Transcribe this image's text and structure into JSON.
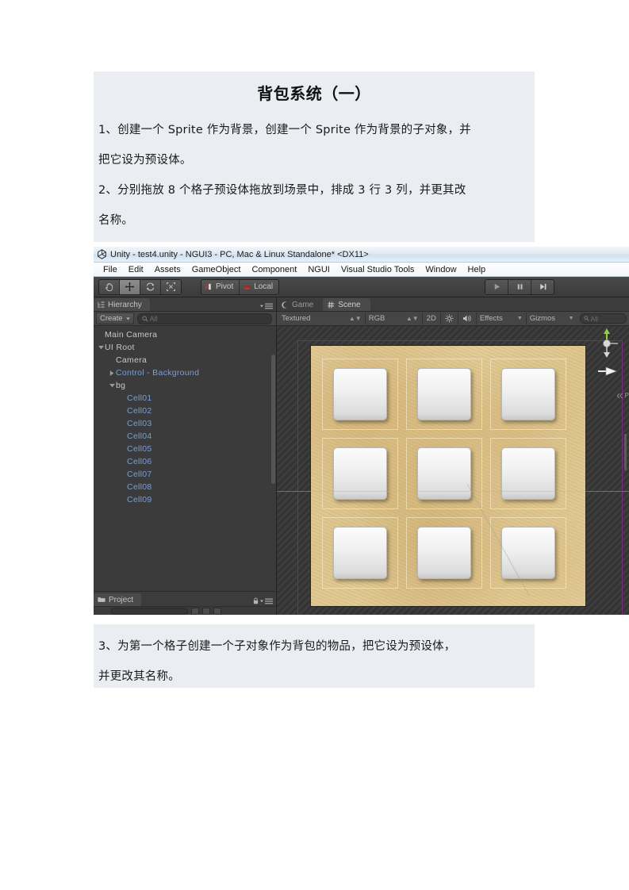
{
  "document": {
    "title": "背包系统（一）",
    "paragraphs_top": [
      "1、创建一个 Sprite 作为背景，创建一个 Sprite 作为背景的子对象，并",
      "把它设为预设体。",
      "2、分别拖放 8 个格子预设体拖放到场景中，排成 3 行 3 列，并更其改",
      "名称。"
    ],
    "paragraphs_bottom": [
      "3、为第一个格子创建一个子对象作为背包的物品，把它设为预设体，",
      "并更改其名称。"
    ],
    "background_color": "#eaeef2"
  },
  "unity": {
    "titlebar": {
      "text": "Unity - test4.unity - NGUI3 - PC, Mac & Linux Standalone* <DX11>",
      "icon": "unity-logo-icon"
    },
    "menubar": [
      "File",
      "Edit",
      "Assets",
      "GameObject",
      "Component",
      "NGUI",
      "Visual Studio Tools",
      "Window",
      "Help"
    ],
    "toolbar": {
      "transform_tools": [
        {
          "name": "hand-tool",
          "icon": "hand-icon",
          "active": false
        },
        {
          "name": "move-tool",
          "icon": "move-arrows-icon",
          "active": true
        },
        {
          "name": "rotate-tool",
          "icon": "rotate-icon",
          "active": false
        },
        {
          "name": "scale-tool",
          "icon": "scale-icon",
          "active": false
        }
      ],
      "pivot_label": "Pivot",
      "local_label": "Local",
      "play_buttons": [
        {
          "name": "play-button",
          "icon": "play-icon"
        },
        {
          "name": "pause-button",
          "icon": "pause-icon"
        },
        {
          "name": "step-button",
          "icon": "step-icon"
        }
      ]
    },
    "hierarchy": {
      "tab_label": "Hierarchy",
      "tab_icon": "hierarchy-icon",
      "create_label": "Create",
      "search_placeholder": "All",
      "tree": [
        {
          "label": "Main Camera",
          "indent": 0,
          "arrow": "none",
          "prefab": false
        },
        {
          "label": "UI Root",
          "indent": 0,
          "arrow": "down",
          "prefab": false
        },
        {
          "label": "Camera",
          "indent": 1,
          "arrow": "none",
          "prefab": false
        },
        {
          "label": "Control - Background",
          "indent": 1,
          "arrow": "right",
          "prefab": true
        },
        {
          "label": "bg",
          "indent": 1,
          "arrow": "down",
          "prefab": false
        },
        {
          "label": "Cell01",
          "indent": 2,
          "arrow": "none",
          "prefab": true
        },
        {
          "label": "Cell02",
          "indent": 2,
          "arrow": "none",
          "prefab": true
        },
        {
          "label": "Cell03",
          "indent": 2,
          "arrow": "none",
          "prefab": true
        },
        {
          "label": "Cell04",
          "indent": 2,
          "arrow": "none",
          "prefab": true
        },
        {
          "label": "Cell05",
          "indent": 2,
          "arrow": "none",
          "prefab": true
        },
        {
          "label": "Cell06",
          "indent": 2,
          "arrow": "none",
          "prefab": true
        },
        {
          "label": "Cell07",
          "indent": 2,
          "arrow": "none",
          "prefab": true
        },
        {
          "label": "Cell08",
          "indent": 2,
          "arrow": "none",
          "prefab": true
        },
        {
          "label": "Cell09",
          "indent": 2,
          "arrow": "none",
          "prefab": true
        }
      ],
      "prefab_text_color": "#7a9fd4"
    },
    "project": {
      "tab_label": "Project",
      "tab_icon": "folder-icon",
      "lock_icon": "lock-icon"
    },
    "scene_panel": {
      "tabs": [
        {
          "label": "Game",
          "icon": "game-icon",
          "active": false
        },
        {
          "label": "Scene",
          "icon": "scene-grid-icon",
          "active": true
        }
      ],
      "toolbar": {
        "draw_mode": "Textured",
        "color_mode": "RGB",
        "mode_2d": "2D",
        "lighting_icon": "sun-icon",
        "audio_icon": "speaker-icon",
        "effects_label": "Effects",
        "gizmos_label": "Gizmos",
        "search_placeholder": "All"
      },
      "viewport": {
        "canvas_border_color": "#7a2b7a",
        "board_color": "#e5cf9a",
        "cell_count": 9,
        "cell_rows": 3,
        "cell_cols": 3,
        "perspective_label": "P",
        "gizmo_name": "scene-axis-gizmo"
      }
    }
  }
}
